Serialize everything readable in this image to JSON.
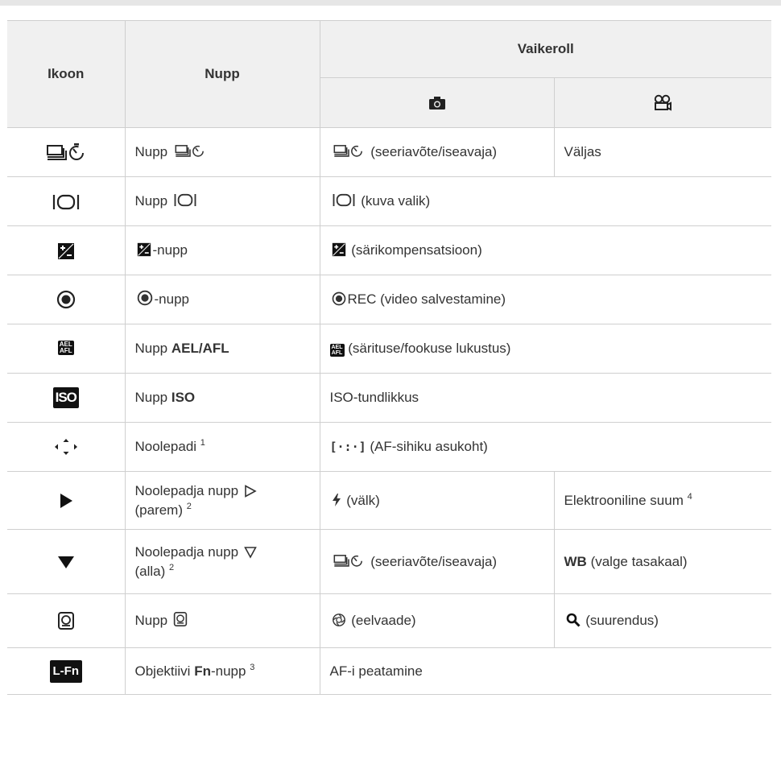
{
  "header": {
    "icon_col": "Ikoon",
    "button_col": "Nupp",
    "default_role": "Vaikeroll",
    "photo_icon": "camera-icon",
    "video_icon": "movie-camera-icon"
  },
  "rows": [
    {
      "button_prefix": "Nupp",
      "photo": "(seeriavõte/iseavaja)",
      "video": "Väljas"
    },
    {
      "button_prefix": "Nupp",
      "photo": "(kuva valik)"
    },
    {
      "button_suffix": "-nupp",
      "photo": "(särikompensatsioon)"
    },
    {
      "button_suffix": "-nupp",
      "photo": "REC (video salvestamine)"
    },
    {
      "button_prefix": "Nupp",
      "button_bold": "AEL/AFL",
      "photo": "(särituse/fookuse lukustus)",
      "icon_text_top": "AEL",
      "icon_text_bottom": "AFL"
    },
    {
      "button_prefix": "Nupp",
      "button_bold": "ISO",
      "photo": "ISO-tundlikkus",
      "icon_text": "ISO"
    },
    {
      "button": "Noolepadi",
      "button_sup": "1",
      "photo_bracket": "[·:·]",
      "photo": "(AF-sihiku asukoht)"
    },
    {
      "button_line1": "Noolepadja nupp",
      "button_line2": "(parem)",
      "button_sup": "2",
      "photo": "(välk)",
      "video": "Elektrooniline suum",
      "video_sup": "4"
    },
    {
      "button_line1": "Noolepadja nupp",
      "button_line2": "(alla)",
      "button_sup": "2",
      "photo": "(seeriavõte/iseavaja)",
      "video_bold": "WB",
      "video": "(valge tasakaal)"
    },
    {
      "button_prefix": "Nupp",
      "photo": "(eelvaade)",
      "video": "(suurendus)"
    },
    {
      "button_prefix": "Objektiivi",
      "button_bold": "Fn",
      "button_suffix": "-nupp",
      "button_sup": "3",
      "photo": "AF-i peatamine",
      "icon_text": "L-Fn"
    }
  ]
}
